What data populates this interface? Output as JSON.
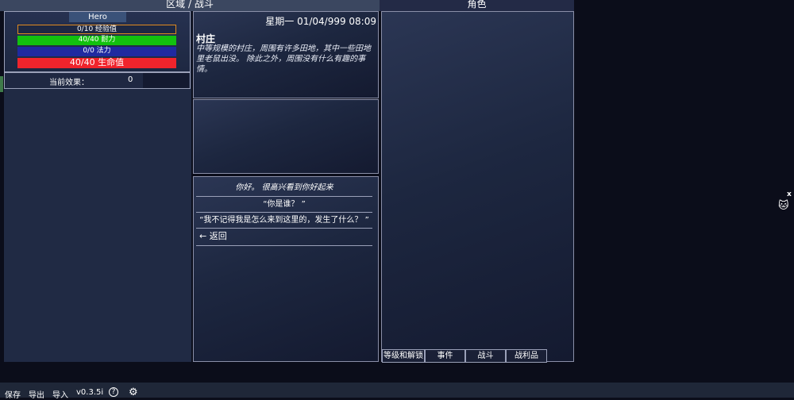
{
  "tabs": {
    "area": "区域 / 战斗",
    "character": "角色"
  },
  "hero": {
    "name": "Hero",
    "exp": "0/10 经验值",
    "stamina": "40/40 耐力",
    "mana": "0/0 法力",
    "hp": "40/40 生命值"
  },
  "effects": {
    "label": "当前效果：",
    "value": "0"
  },
  "location": {
    "datetime": "星期一 01/04/999 08:09",
    "name": "村庄",
    "description": "中等规模的村庄，周围有许多田地，其中一些田地里老鼠出没。 除此之外，周围没有什么有趣的事情。"
  },
  "dialogue": {
    "greeting": "你好。 很高兴看到你好起来",
    "option1": "“你是谁？ ”",
    "option2": "“我不记得我是怎么来到这里的，发生了什么？ ”",
    "back": "返回"
  },
  "character_tabs": [
    "等级和解锁",
    "事件",
    "战斗",
    "战利品"
  ],
  "bottom": {
    "save": "保存",
    "export": "导出",
    "import": "导入",
    "version": "v0.3.5i",
    "help": "?"
  },
  "side": {
    "close": "x"
  },
  "colors": {
    "exp_border": "#e08a1f",
    "stamina": "#12c10f",
    "mana": "#1f2aa0",
    "hp": "#f0242c"
  },
  "icons": [
    "help-icon",
    "gear-icon",
    "back-arrow-icon",
    "cat-icon",
    "close-icon"
  ]
}
